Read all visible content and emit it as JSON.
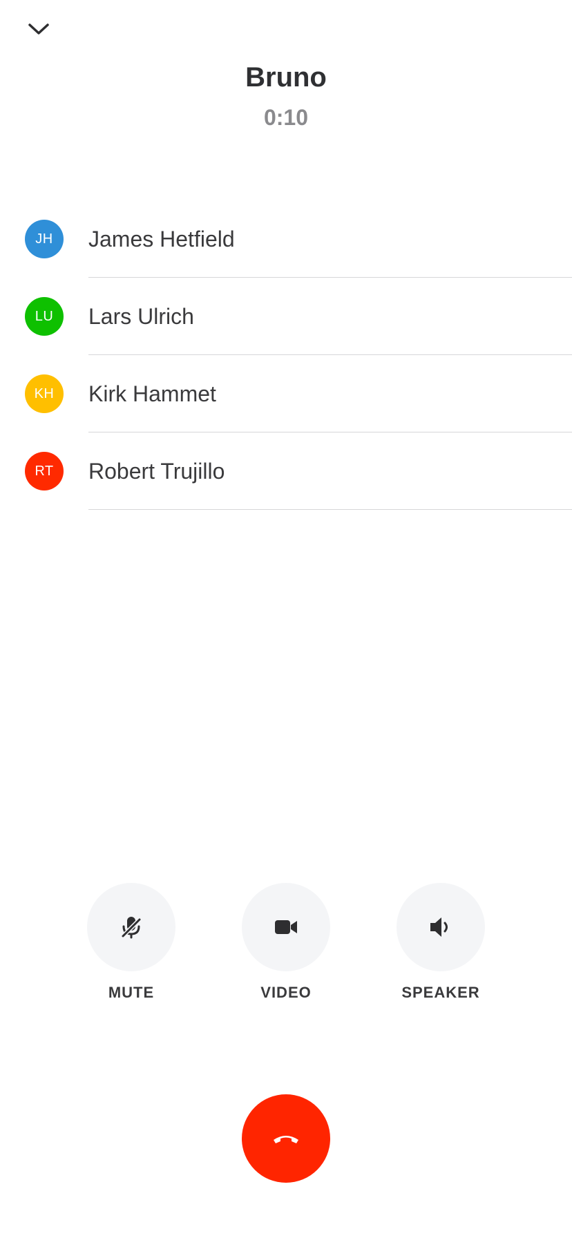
{
  "call": {
    "title": "Bruno",
    "timer": "0:10"
  },
  "participants": [
    {
      "initials": "JH",
      "name": "James Hetfield",
      "color": "#2f8fd8"
    },
    {
      "initials": "LU",
      "name": "Lars Ulrich",
      "color": "#0ec000"
    },
    {
      "initials": "KH",
      "name": "Kirk Hammet",
      "color": "#ffbf00"
    },
    {
      "initials": "RT",
      "name": "Robert Trujillo",
      "color": "#ff2a00"
    }
  ],
  "controls": {
    "mute": {
      "label": "MUTE",
      "icon": "microphone-off-icon"
    },
    "video": {
      "label": "VIDEO",
      "icon": "video-camera-icon"
    },
    "speaker": {
      "label": "SPEAKER",
      "icon": "speaker-icon"
    }
  },
  "end_call": {
    "icon": "hang-up-phone-icon",
    "color": "#ff2500"
  },
  "collapse": {
    "icon": "chevron-down-icon"
  }
}
